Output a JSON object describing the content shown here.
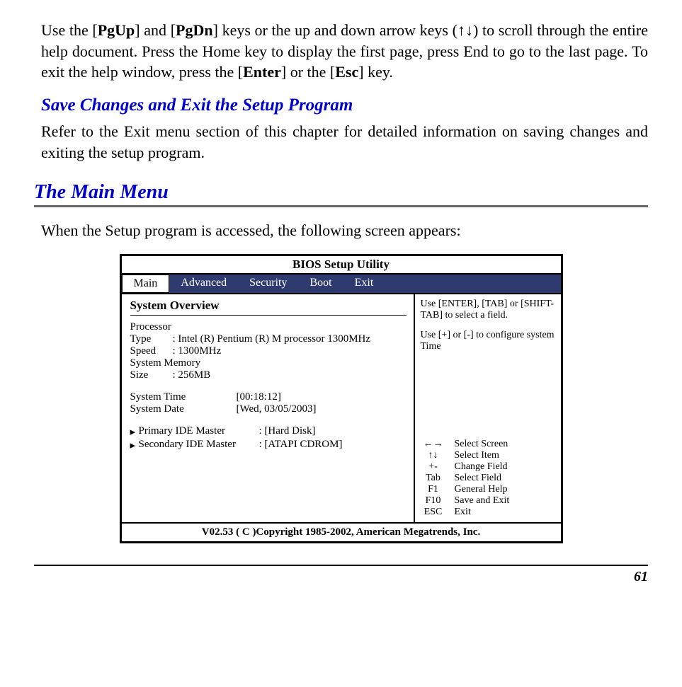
{
  "paragraphs": {
    "p1a": "Use the [",
    "p1_pgup": "PgUp",
    "p1b": "] and [",
    "p1_pgdn": "PgDn",
    "p1c": "] keys or the up and down arrow keys (",
    "p1_arrows": "↑↓",
    "p1d": ") to scroll through the entire help document.   Press the Home key to display the first page, press End to go to the last page.  To exit the help window, press the [",
    "p1_enter": "Enter",
    "p1e": "] or the [",
    "p1_esc": "Esc",
    "p1f": "] key.",
    "p2": "Refer to the Exit menu section of this chapter for detailed information on saving changes and exiting the setup program.",
    "p3": "When the Setup program is accessed, the following screen appears:"
  },
  "headings": {
    "sub": "Save Changes and Exit the Setup Program",
    "main": "The Main Menu"
  },
  "bios": {
    "title": "BIOS Setup Utility",
    "tabs": [
      "Main",
      "Advanced",
      "Security",
      "Boot",
      "Exit"
    ],
    "sysOverview": "System Overview",
    "procHeader": "Processor",
    "typeLabel": "Type",
    "typeValue": "Intel (R)  Pentium (R)  M processor 1300MHz",
    "speedLabel": "Speed",
    "speedValue": "1300MHz",
    "sysMemHeader": "System Memory",
    "sizeLabel": "Size",
    "sizeValue": "256MB",
    "timeLabel": "System Time",
    "timeValue": "[00:18:12]",
    "dateLabel": "System Date",
    "dateValue": "[Wed, 03/05/2003]",
    "pide": "Primary IDE Master",
    "pideVal": "[Hard Disk]",
    "side": "Secondary IDE Master",
    "sideVal": "[ATAPI CDROM]",
    "rightHelp1": "Use [ENTER], [TAB] or [SHIFT-TAB] to select a field.",
    "rightHelp2": "Use [+] or [-] to configure system Time",
    "keys": [
      {
        "k": "←→",
        "d": "Select Screen"
      },
      {
        "k": "↑↓",
        "d": "Select Item"
      },
      {
        "k": "+-",
        "d": "Change Field"
      },
      {
        "k": "Tab",
        "d": "Select Field"
      },
      {
        "k": "F1",
        "d": "General Help"
      },
      {
        "k": "F10",
        "d": "Save and Exit"
      },
      {
        "k": "ESC",
        "d": "Exit"
      }
    ],
    "footer": "V02.53 ( C )Copyright 1985-2002, American Megatrends, Inc."
  },
  "pageNumber": "61"
}
